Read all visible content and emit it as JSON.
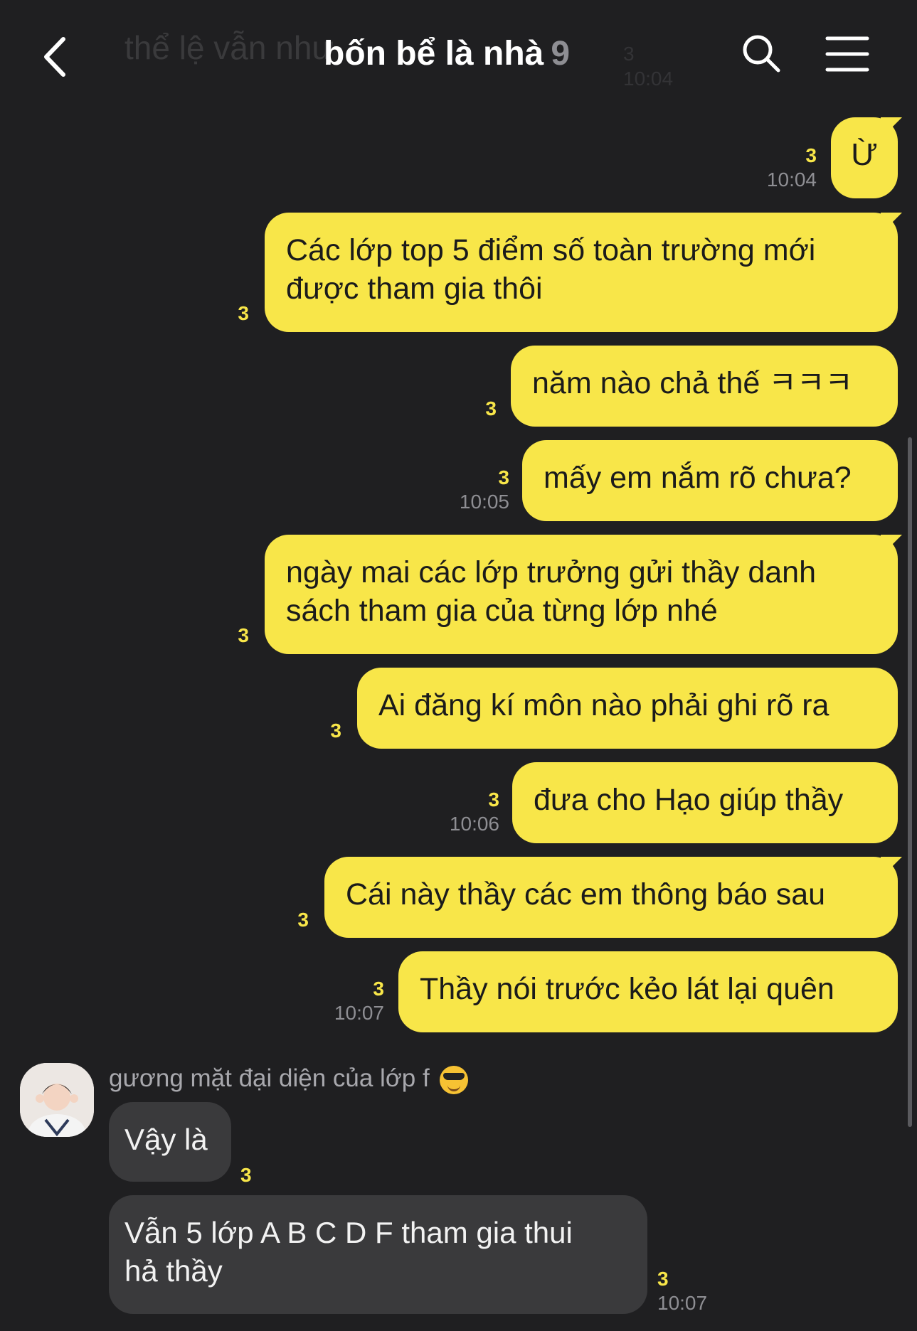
{
  "header": {
    "title": "bốn bể là nhà",
    "member_count": "9",
    "ghost_text": "thể lệ vẫn như",
    "ghost_unread": "3",
    "ghost_time": "10:04"
  },
  "messages": [
    {
      "text": "Ừ",
      "unread": "3",
      "time": "10:04"
    },
    {
      "text": "Các lớp top 5 điểm số toàn trường mới",
      "text2": "được tham gia thôi",
      "unread": "3",
      "time": ""
    },
    {
      "text": "năm nào chả thế ㅋㅋㅋ",
      "unread": "3",
      "time": ""
    },
    {
      "text": "mấy em nắm rõ chưa?",
      "unread": "3",
      "time": "10:05"
    },
    {
      "text": "ngày mai các lớp trưởng gửi thầy danh",
      "text2": "sách tham gia của từng lớp nhé",
      "unread": "3",
      "time": ""
    },
    {
      "text": "Ai đăng kí môn nào phải ghi rõ ra",
      "unread": "3",
      "time": ""
    },
    {
      "text": "đưa cho Hạo giúp thầy",
      "unread": "3",
      "time": "10:06"
    },
    {
      "text": "Cái này thầy các em thông báo sau",
      "unread": "3",
      "time": ""
    },
    {
      "text": "Thầy nói trước kẻo lát lại quên",
      "unread": "3",
      "time": "10:07"
    }
  ],
  "other": {
    "sender": "gương mặt đại diện của lớp f",
    "messages": [
      {
        "text": "Vậy là",
        "unread": "3",
        "time": ""
      },
      {
        "text": "Vẫn 5 lớp A B C D F tham gia thui",
        "text2": "hả thầy",
        "unread": "3",
        "time": "10:07"
      }
    ]
  },
  "colors": {
    "background": "#1f1f21",
    "my_bubble": "#f8e649",
    "other_bubble": "#3a3a3c",
    "unread": "#f8e649"
  },
  "icons": [
    "back-arrow-icon",
    "search-icon",
    "menu-icon",
    "sunglasses-emoji-icon"
  ]
}
